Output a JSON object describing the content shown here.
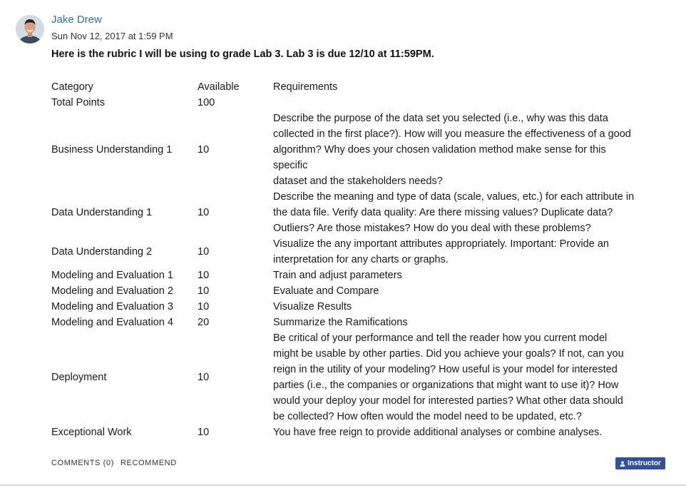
{
  "post": {
    "author": "Jake Drew",
    "timestamp": "Sun Nov 12, 2017 at 1:59 PM",
    "headline": "Here is the rubric I will be using to grade Lab 3.  Lab 3 is due 12/10 at 11:59PM."
  },
  "rubric": {
    "headers": [
      "Category",
      "Available",
      "Requirements"
    ],
    "rows": [
      {
        "category": "Total Points",
        "available": "100",
        "requirements": []
      },
      {
        "category": "Business Understanding 1",
        "available": "10",
        "requirements": [
          "Describe the purpose of the data set you selected (i.e., why was this data",
          "collected in the first place?). How will you measure the effectiveness of a good",
          "algorithm? Why does your chosen validation method make sense for this",
          "specific",
          "dataset and the stakeholders needs?"
        ]
      },
      {
        "category": "Data Understanding 1",
        "available": "10",
        "requirements": [
          "Describe the meaning and type of data (scale, values, etc.) for each attribute in",
          "the data file. Verify data quality: Are there missing values? Duplicate data?",
          "Outliers? Are those mistakes? How do you deal with these problems?"
        ]
      },
      {
        "category": "Data Understanding 2",
        "available": "10",
        "requirements": [
          "Visualize the any important attributes appropriately. Important: Provide an",
          "interpretation for any charts or graphs."
        ]
      },
      {
        "category": "Modeling and Evaluation 1",
        "available": "10",
        "requirements": [
          "Train and adjust parameters"
        ]
      },
      {
        "category": "Modeling and Evaluation 2",
        "available": "10",
        "requirements": [
          "Evaluate and Compare"
        ]
      },
      {
        "category": "Modeling and Evaluation 3",
        "available": "10",
        "requirements": [
          "Visualize Results"
        ]
      },
      {
        "category": "Modeling and Evaluation 4",
        "available": "20",
        "requirements": [
          "Summarize the Ramifications"
        ]
      },
      {
        "category": "Deployment",
        "available": "10",
        "requirements": [
          "Be critical of your performance and tell the reader how you current model",
          "might be usable by other parties. Did you achieve your goals? If not, can you",
          "reign in the utility of your modeling? How useful is your model for interested",
          "parties (i.e., the companies or organizations that might want to use it)? How",
          "would your deploy your model for interested parties? What other data should",
          "be collected? How often would the model need to be updated, etc.?"
        ]
      },
      {
        "category": "Exceptional Work",
        "available": "10",
        "requirements": [
          "You have free reign to provide additional analyses or combine analyses."
        ]
      }
    ]
  },
  "footer": {
    "comments_label": "COMMENTS (0)",
    "recommend_label": "RECOMMEND",
    "badge_label": "Instructor",
    "badge_color": "#33509a"
  },
  "icons": {
    "badge_icon": "user-icon"
  }
}
